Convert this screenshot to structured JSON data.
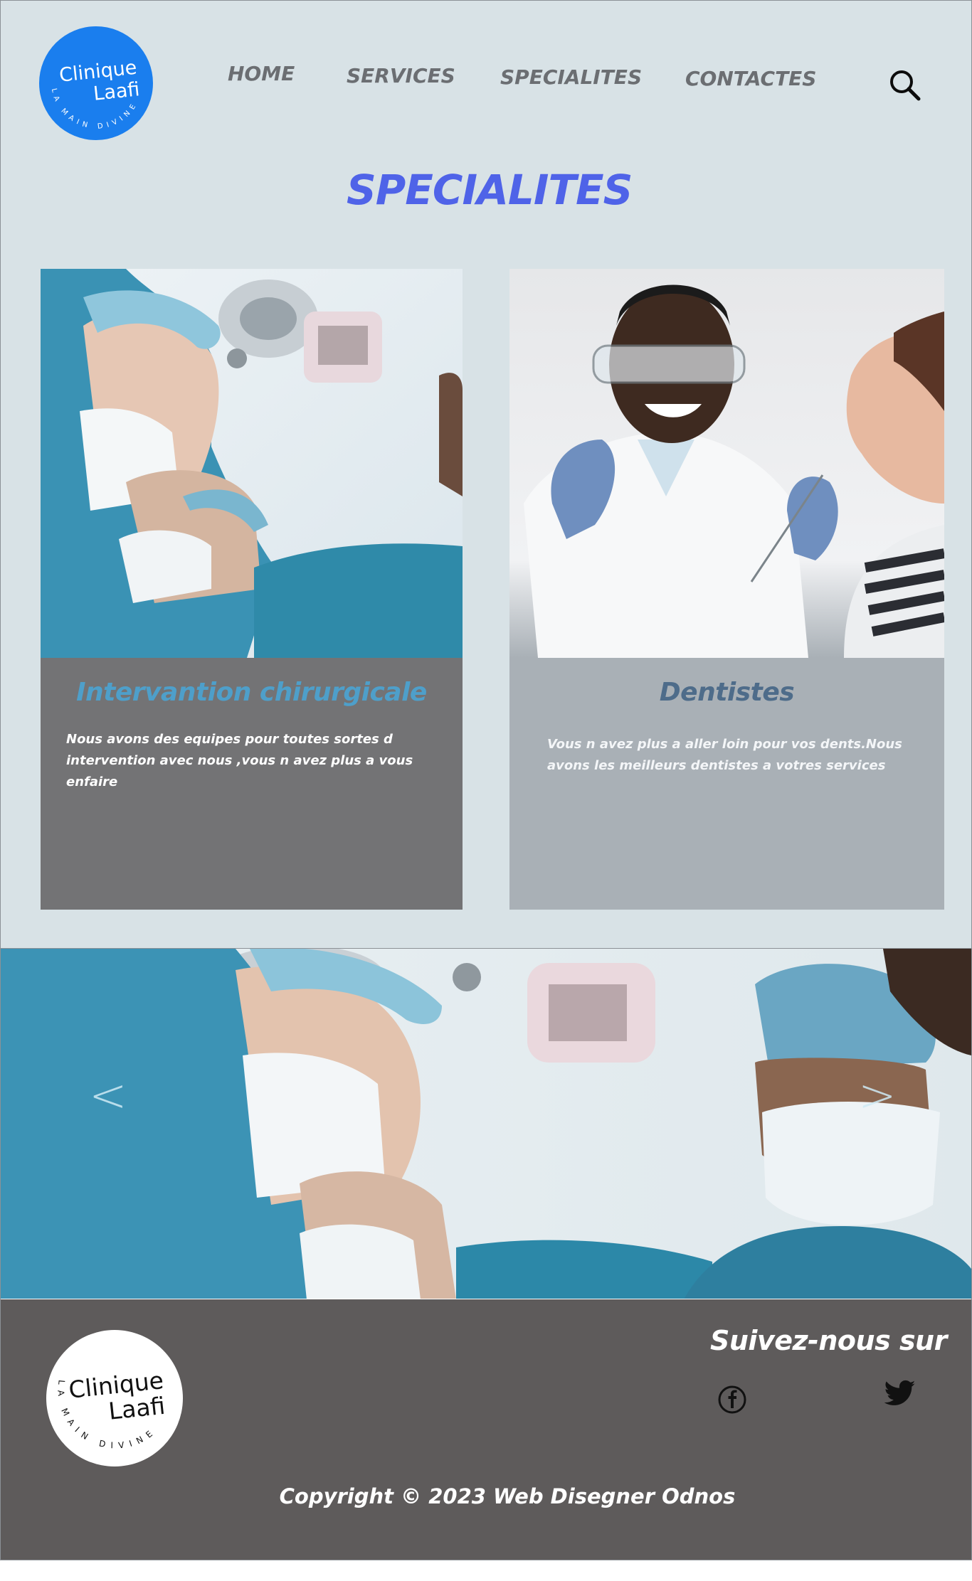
{
  "brand": {
    "name_line1": "Clinique",
    "name_line2": "Laafi",
    "tagline": "LA MAIN DIVINE"
  },
  "nav": {
    "items": [
      "HOME",
      "SERVICES",
      "SPECIALITES",
      "CONTACTES"
    ]
  },
  "page": {
    "title": "SPECIALITES"
  },
  "cards": [
    {
      "title": "Intervantion chirurgicale",
      "text": "Nous avons des equipes pour toutes sortes d intervention avec nous ,vous n avez  plus a vous enfaire"
    },
    {
      "title": "Dentistes",
      "text": "Vous n avez plus a aller loin pour vos dents.Nous avons les meilleurs dentistes a votres services"
    }
  ],
  "slider": {
    "prev": "<",
    "next": ">"
  },
  "footer": {
    "follow": "Suivez-nous sur",
    "copyright": "Copyright © 2023 Web Disegner Odnos"
  },
  "icons": {
    "search": "search-icon",
    "facebook": "facebook-icon",
    "twitter": "twitter-icon"
  },
  "colors": {
    "background": "#d8e2e6",
    "title": "#4f63e8",
    "logo": "#1a7eee",
    "footer": "#5e5b5b",
    "card1": "#737375",
    "card2": "#a9b0b6"
  }
}
